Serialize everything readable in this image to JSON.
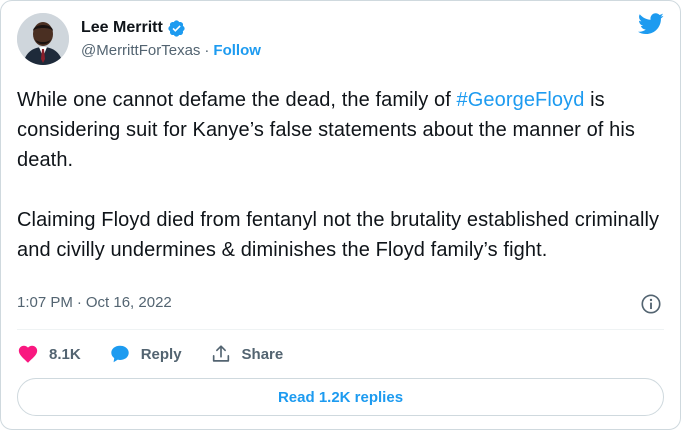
{
  "author": {
    "display_name": "Lee Merritt",
    "handle": "@MerrittForTexas",
    "separator": "·",
    "follow_label": "Follow",
    "verified": true
  },
  "tweet": {
    "line1_before": "While one cannot defame the dead, the family of ",
    "hashtag": "#GeorgeFloyd",
    "line1_after": " is considering suit for Kanye’s false statements about the manner of his death.",
    "paragraph2": "Claiming Floyd died from fentanyl not the brutality established criminally and civilly undermines & diminishes the Floyd family’s fight."
  },
  "meta": {
    "time": "1:07 PM",
    "separator": "·",
    "date": "Oct 16, 2022"
  },
  "actions": {
    "like_count": "8.1K",
    "reply_label": "Reply",
    "share_label": "Share"
  },
  "read_replies_label": "Read 1.2K replies",
  "colors": {
    "accent": "#1d9bf0",
    "like": "#f91880",
    "text": "#0f1419",
    "secondary": "#536471"
  },
  "icons": {
    "bird": "twitter-bird-icon",
    "verified": "verified-badge-icon",
    "info": "info-icon",
    "like": "heart-icon",
    "reply": "speech-bubble-icon",
    "share": "share-upload-icon"
  }
}
